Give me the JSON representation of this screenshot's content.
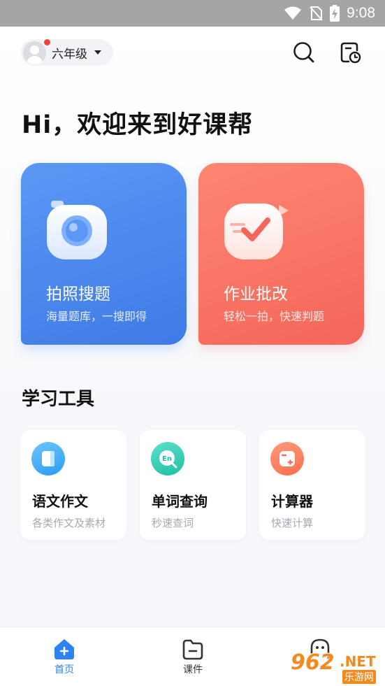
{
  "status_bar": {
    "time": "9:08"
  },
  "header": {
    "grade": "六年级",
    "greeting": "Hi，欢迎来到好课帮"
  },
  "feature_cards": [
    {
      "title": "拍照搜题",
      "subtitle": "海量题库，一搜即得",
      "icon": "camera-icon",
      "color": "#4a86ee"
    },
    {
      "title": "作业批改",
      "subtitle": "轻松一拍，快速判题",
      "icon": "checkmark-icon",
      "color": "#f9705f"
    }
  ],
  "tools_section": {
    "title": "学习工具",
    "items": [
      {
        "name": "语文作文",
        "desc": "各类作文及素材",
        "icon": "book-icon",
        "color": "#3aa8f8"
      },
      {
        "name": "单词查询",
        "desc": "秒速查词",
        "icon": "word-lookup-icon",
        "color": "#2ecbb2"
      },
      {
        "name": "计算器",
        "desc": "快速计算",
        "icon": "calculator-icon",
        "color": "#fd7a57"
      }
    ]
  },
  "bottom_nav": {
    "items": [
      {
        "label": "首页",
        "icon": "home-icon",
        "active": true
      },
      {
        "label": "课件",
        "icon": "folder-icon",
        "active": false
      },
      {
        "label": "",
        "icon": "profile-icon",
        "active": false
      }
    ]
  },
  "watermark": {
    "number": "962",
    "suffix": ".NET",
    "sub": "乐游网"
  },
  "colors": {
    "accent": "#2d83f4",
    "background": "#f7f8fb"
  }
}
